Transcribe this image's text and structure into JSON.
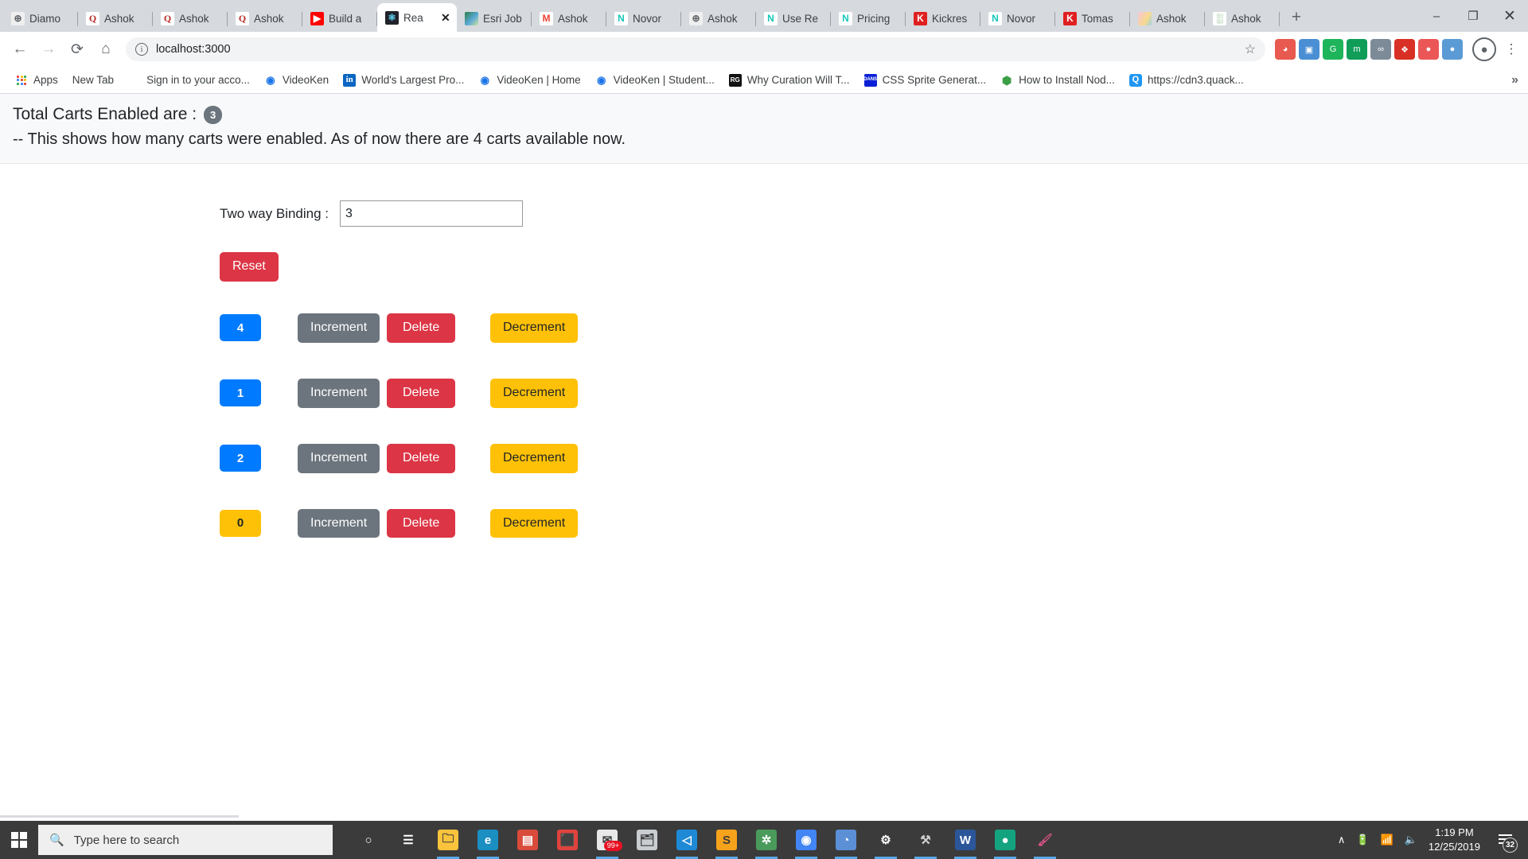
{
  "browser": {
    "tabs": [
      {
        "label": "Diamo",
        "icon": "globe-icon",
        "icon_class": "fi-globe",
        "glyph": "⊕",
        "active": false
      },
      {
        "label": "Ashok",
        "icon": "quora-icon",
        "icon_class": "fi-quora",
        "glyph": "Q",
        "active": false
      },
      {
        "label": "Ashok",
        "icon": "quora-icon",
        "icon_class": "fi-quora",
        "glyph": "Q",
        "active": false
      },
      {
        "label": "Ashok",
        "icon": "quora-icon",
        "icon_class": "fi-quora",
        "glyph": "Q",
        "active": false
      },
      {
        "label": "Build a",
        "icon": "youtube-icon",
        "icon_class": "fi-yt",
        "glyph": "▶",
        "active": false
      },
      {
        "label": "Rea",
        "icon": "react-icon",
        "icon_class": "fi-react",
        "glyph": "⚛",
        "active": true
      },
      {
        "label": "Esri Job",
        "icon": "esri-icon",
        "icon_class": "fi-esri",
        "glyph": "",
        "active": false
      },
      {
        "label": "Ashok",
        "icon": "gmail-icon",
        "icon_class": "fi-gmail",
        "glyph": "M",
        "active": false
      },
      {
        "label": "Novor",
        "icon": "novoresume-icon",
        "icon_class": "fi-novo",
        "glyph": "N",
        "active": false
      },
      {
        "label": "Ashok",
        "icon": "globe-icon",
        "icon_class": "fi-globe",
        "glyph": "⊕",
        "active": false
      },
      {
        "label": "Use Re",
        "icon": "novoresume-icon",
        "icon_class": "fi-novo",
        "glyph": "N",
        "active": false
      },
      {
        "label": "Pricing",
        "icon": "novoresume-icon",
        "icon_class": "fi-novo",
        "glyph": "N",
        "active": false
      },
      {
        "label": "Kickres",
        "icon": "kickresume-icon",
        "icon_class": "fi-kick",
        "glyph": "K",
        "active": false
      },
      {
        "label": "Novor",
        "icon": "novoresume-icon",
        "icon_class": "fi-novo",
        "glyph": "N",
        "active": false
      },
      {
        "label": "Tomas",
        "icon": "kickresume-icon",
        "icon_class": "fi-kick",
        "glyph": "K",
        "active": false
      },
      {
        "label": "Ashok",
        "icon": "easter-egg-icon",
        "icon_class": "fi-egg",
        "glyph": "",
        "active": false
      },
      {
        "label": "Ashok",
        "icon": "grid-app-icon",
        "icon_class": "fi-grid",
        "glyph": "░",
        "active": false
      }
    ],
    "new_tab_label": "+",
    "window_controls": {
      "minimize": "–",
      "maximize": "❐",
      "close": "✕"
    },
    "toolbar": {
      "back": "←",
      "forward": "→",
      "reload": "⟳",
      "home": "⌂",
      "info_glyph": "i",
      "url": "localhost:3000",
      "bookmark_star": "☆",
      "profile_glyph": "●",
      "menu_glyph": "⋮",
      "extensions": [
        {
          "name": "palette-extension-icon",
          "glyph": "◕",
          "color": "#e8594f"
        },
        {
          "name": "screen-extension-icon",
          "glyph": "▣",
          "color": "#4a8fd4"
        },
        {
          "name": "grammarly-extension-icon",
          "glyph": "G",
          "color": "#1db45a"
        },
        {
          "name": "contact-extension-icon",
          "glyph": "m",
          "color": "#0f9d58"
        },
        {
          "name": "link-extension-icon",
          "glyph": "∞",
          "color": "#7d8b99"
        },
        {
          "name": "red-extension-icon",
          "glyph": "❖",
          "color": "#d93025"
        },
        {
          "name": "shield-extension-icon",
          "glyph": "●",
          "color": "#eb5757"
        },
        {
          "name": "blue-extension-icon",
          "glyph": "●",
          "color": "#5b9bd5"
        }
      ]
    },
    "bookmarks": [
      {
        "label": "Apps",
        "icon": "apps-grid-icon",
        "icon_class": "ic-apps",
        "glyph": ""
      },
      {
        "label": "New Tab",
        "icon": "new-tab-icon",
        "icon_class": "",
        "glyph": ""
      },
      {
        "label": "Sign in to your acco...",
        "icon": "microsoft-icon",
        "icon_class": "ic-ms",
        "glyph": ""
      },
      {
        "label": "VideoKen",
        "icon": "videoken-icon",
        "icon_class": "ic-vk",
        "glyph": "◉"
      },
      {
        "label": "World's Largest Pro...",
        "icon": "linkedin-icon",
        "icon_class": "ic-li",
        "glyph": "in"
      },
      {
        "label": "VideoKen | Home",
        "icon": "videoken-icon",
        "icon_class": "ic-vk",
        "glyph": "◉"
      },
      {
        "label": "VideoKen | Student...",
        "icon": "videoken-icon",
        "icon_class": "ic-vk",
        "glyph": "◉"
      },
      {
        "label": "Why Curation Will T...",
        "icon": "researchgate-icon",
        "icon_class": "ic-rg",
        "glyph": "RG"
      },
      {
        "label": "CSS Sprite Generat...",
        "icon": "css-tools-icon",
        "icon_class": "ic-css",
        "glyph": "DANS"
      },
      {
        "label": "How to Install Nod...",
        "icon": "nodejs-icon",
        "icon_class": "ic-node",
        "glyph": "⬢"
      },
      {
        "label": "https://cdn3.quack...",
        "icon": "quack-icon",
        "icon_class": "ic-quack",
        "glyph": "Q"
      }
    ],
    "bookmarks_overflow": "»"
  },
  "page": {
    "alert": {
      "title_text": "Total Carts Enabled are :",
      "count": "3",
      "description": "-- This shows how many carts were enabled. As of now there are 4 carts available now."
    },
    "form": {
      "binding_label": "Two way Binding :",
      "binding_value": "3",
      "binding_placeholder": "",
      "reset_label": "Reset"
    },
    "rows": [
      {
        "value": "4",
        "style": "primary",
        "increment_label": "Increment",
        "delete_label": "Delete",
        "decrement_label": "Decrement"
      },
      {
        "value": "1",
        "style": "primary",
        "increment_label": "Increment",
        "delete_label": "Delete",
        "decrement_label": "Decrement"
      },
      {
        "value": "2",
        "style": "primary",
        "increment_label": "Increment",
        "delete_label": "Delete",
        "decrement_label": "Decrement"
      },
      {
        "value": "0",
        "style": "warning",
        "increment_label": "Increment",
        "delete_label": "Delete",
        "decrement_label": "Decrement"
      }
    ],
    "colors": {
      "primary": "#007bff",
      "secondary": "#6c757d",
      "danger": "#dc3545",
      "warning": "#ffc107",
      "banner_bg": "#f8f9fa"
    }
  },
  "taskbar": {
    "start_label": "Start",
    "search_placeholder": "Type here to search",
    "search_icon": "magnifier-icon",
    "items": [
      {
        "name": "cortana-icon",
        "glyph": "○",
        "color": "transparent",
        "fg": "#ffffff",
        "open": false,
        "badge": ""
      },
      {
        "name": "task-view-icon",
        "glyph": "☰",
        "color": "transparent",
        "fg": "#ffffff",
        "open": false,
        "badge": ""
      },
      {
        "name": "file-explorer-icon",
        "glyph": "🗀",
        "color": "#f9c33c",
        "fg": "#3b3b3b",
        "open": true,
        "badge": ""
      },
      {
        "name": "edge-icon",
        "glyph": "e",
        "color": "#1b8ec2",
        "fg": "#ffffff",
        "open": true,
        "badge": ""
      },
      {
        "name": "microsoft-store-icon",
        "glyph": "▤",
        "color": "#d94b3a",
        "fg": "#ffffff",
        "open": false,
        "badge": ""
      },
      {
        "name": "gift-icon",
        "glyph": "⬛",
        "color": "#e0433d",
        "fg": "#ffffff",
        "open": false,
        "badge": ""
      },
      {
        "name": "mail-icon",
        "glyph": "✉",
        "color": "#e8e8e8",
        "fg": "#3b3b3b",
        "open": true,
        "badge": "99+"
      },
      {
        "name": "folder-icon",
        "glyph": "🗂",
        "color": "#c9cdd1",
        "fg": "#3b3b3b",
        "open": false,
        "badge": ""
      },
      {
        "name": "vscode-icon",
        "glyph": "◁",
        "color": "#1e8ad6",
        "fg": "#ffffff",
        "open": true,
        "badge": ""
      },
      {
        "name": "sublime-icon",
        "glyph": "S",
        "color": "#f7a21b",
        "fg": "#3b3b3b",
        "open": true,
        "badge": ""
      },
      {
        "name": "slack-icon",
        "glyph": "✲",
        "color": "#4a9b5b",
        "fg": "#ffffff",
        "open": true,
        "badge": ""
      },
      {
        "name": "chrome-icon",
        "glyph": "◉",
        "color": "#4285f4",
        "fg": "#ffffff",
        "open": true,
        "badge": ""
      },
      {
        "name": "teams-icon",
        "glyph": "◔",
        "color": "#5b8fd6",
        "fg": "#ffffff",
        "open": true,
        "badge": ""
      },
      {
        "name": "settings-gear-icon",
        "glyph": "⚙",
        "color": "transparent",
        "fg": "#ffffff",
        "open": true,
        "badge": ""
      },
      {
        "name": "tools-icon",
        "glyph": "⚒",
        "color": "transparent",
        "fg": "#d0d0d0",
        "open": true,
        "badge": ""
      },
      {
        "name": "word-icon",
        "glyph": "W",
        "color": "#2b579a",
        "fg": "#ffffff",
        "open": true,
        "badge": ""
      },
      {
        "name": "green-app-icon",
        "glyph": "●",
        "color": "#14a37f",
        "fg": "#ffffff",
        "open": true,
        "badge": ""
      },
      {
        "name": "paint-icon",
        "glyph": "🖌",
        "color": "transparent",
        "fg": "#e0548a",
        "open": true,
        "badge": ""
      }
    ],
    "tray": {
      "chevron": "∧",
      "battery_icon": "battery-icon",
      "wifi_icon": "wifi-icon",
      "volume_icon": "volume-icon",
      "time": "1:19 PM",
      "date": "12/25/2019",
      "notification_count": "32"
    }
  }
}
